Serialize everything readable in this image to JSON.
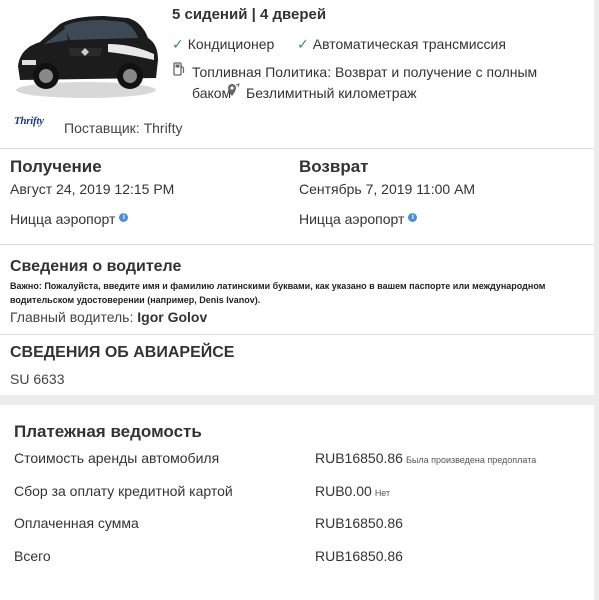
{
  "car": {
    "specs": "5 сидений | 4 дверей",
    "features": {
      "ac": "Кондиционер",
      "transmission": "Автоматическая трансмиссия",
      "fuel_policy_line1": "Топливная Политика: Возврат и получение с полным",
      "fuel_policy_line2": "баком",
      "mileage": "Безлимитный километраж"
    }
  },
  "supplier": {
    "logo_text": "Thrifty",
    "label": "Поставщик: Thrifty"
  },
  "pickup": {
    "heading": "Получение",
    "datetime": "Август 24, 2019 12:15 PM",
    "location": "Ницца аэропорт"
  },
  "dropoff": {
    "heading": "Возврат",
    "datetime": "Сентябрь 7, 2019 11:00 AM",
    "location": "Ницца аэропорт"
  },
  "driver": {
    "heading": "Сведения о водителе",
    "note_line1": "Важно: Пожалуйста, введите имя и фамилию латинскими буквами, как указано в вашем паспорте или международном",
    "note_line2": "водительском удостоверении (например, Denis Ivanov).",
    "main_label": "Главный водитель:",
    "main_name": "Igor Golov"
  },
  "flight": {
    "heading": "СВЕДЕНИЯ ОБ АВИАРЕЙСЕ",
    "number": "SU 6633"
  },
  "payment": {
    "heading": "Платежная ведомость",
    "rows": [
      {
        "label": "Стоимость аренды автомобиля",
        "value": "RUB16850.86",
        "note": "Была произведена предоплата"
      },
      {
        "label": "Сбор за оплату кредитной картой",
        "value": "RUB0.00",
        "note": "Нет"
      },
      {
        "label": "Оплаченная сумма",
        "value": "RUB16850.86",
        "note": ""
      },
      {
        "label": "Всего",
        "value": "RUB16850.86",
        "note": ""
      }
    ]
  },
  "colors": {
    "check": "#2e9b3e",
    "info": "#4a90d9",
    "supplier_brand": "#1a3c8f"
  }
}
